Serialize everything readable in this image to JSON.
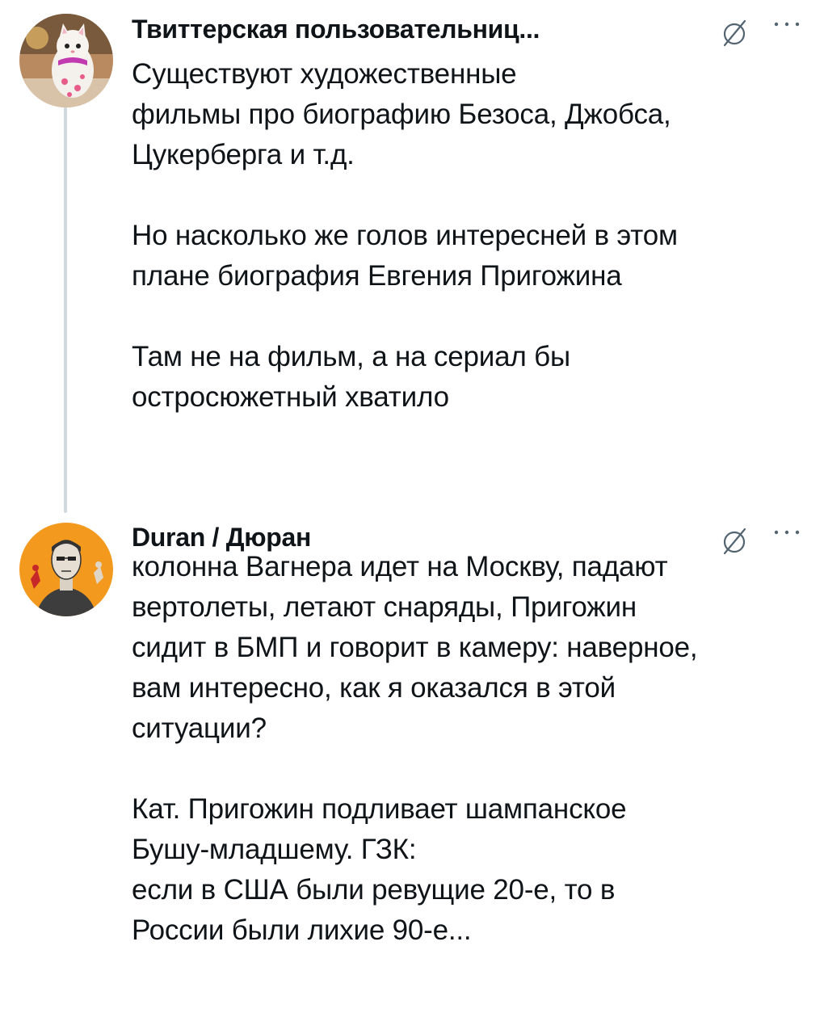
{
  "posts": [
    {
      "author": "Твиттерская пользовательниц...",
      "paragraphs": [
        [
          "Существуют художественные",
          "фильмы про биографию Безоса, Джобса,",
          "Цукерберга и т.д."
        ],
        [
          "Но насколько же голов интересней в этом",
          "плане биография Евгения Пригожина"
        ],
        [
          "Там не на фильм, а на сериал бы",
          "остросюжетный хватило"
        ]
      ]
    },
    {
      "author": "Duran / Дюран",
      "paragraphs": [
        [
          "колонна Вагнера идет на Москву, падают",
          "вертолеты, летают снаряды, Пригожин",
          "сидит в БМП и говорит в камеру: наверное,",
          "вам интересно, как я оказался в этой",
          "ситуации?"
        ],
        [
          "Кат. Пригожин подливает шампанское",
          "Бушу-младшему. ГЗК:",
          "если в США были ревущие 20-е, то в",
          "России были лихие 90-е..."
        ]
      ]
    }
  ],
  "icons": {
    "post_icon": "slashed-circle-icon",
    "menu_icon": "more-options-icon"
  },
  "colors": {
    "text": "#0f1419",
    "thread_line": "#cfd9de",
    "icon": "#536471",
    "avatar1_bg": "#c9a27a",
    "avatar2_bg": "#f39a1e"
  }
}
